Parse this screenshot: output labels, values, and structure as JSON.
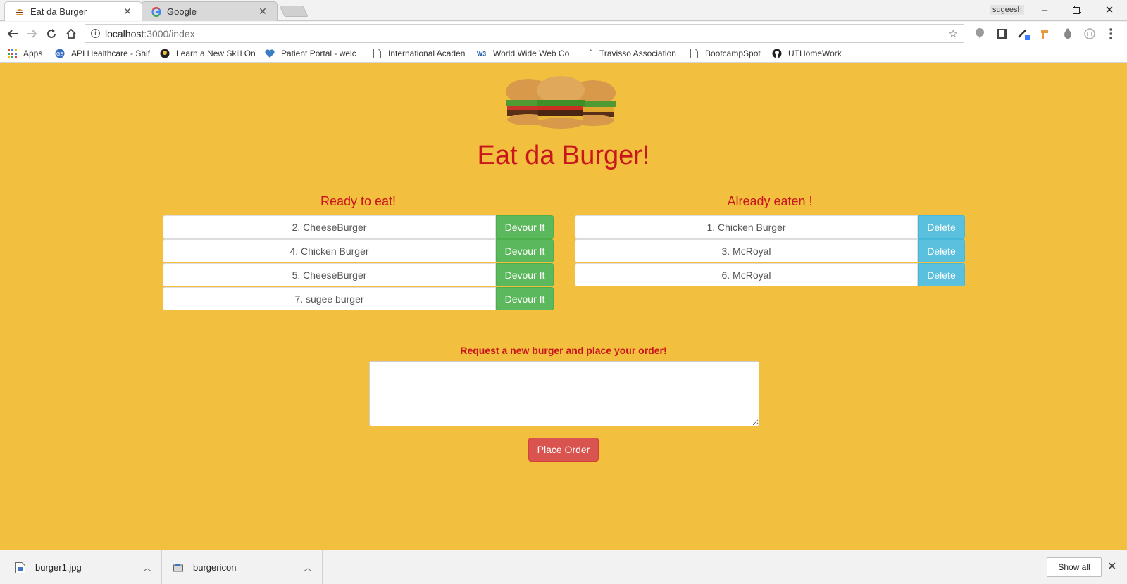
{
  "browser": {
    "tabs": [
      {
        "title": "Eat da Burger",
        "active": true
      },
      {
        "title": "Google",
        "active": false
      }
    ],
    "user": "sugeesh",
    "url": {
      "host": "localhost",
      "path": ":3000/index"
    },
    "bookmarks": [
      {
        "label": "Apps",
        "icon": "apps-grid-icon"
      },
      {
        "label": "API Healthcare - Shif",
        "icon": "ge-logo-icon"
      },
      {
        "label": "Learn a New Skill On",
        "icon": "lynda-icon"
      },
      {
        "label": "Patient Portal - welc",
        "icon": "heart-icon"
      },
      {
        "label": "International Acaden",
        "icon": "page-icon"
      },
      {
        "label": "World Wide Web Co",
        "icon": "w3c-icon"
      },
      {
        "label": "Travisso Association",
        "icon": "page-icon"
      },
      {
        "label": "BootcampSpot",
        "icon": "page-icon"
      },
      {
        "label": "UTHomeWork",
        "icon": "github-icon"
      }
    ]
  },
  "page": {
    "title": "Eat da Burger!",
    "ready_heading": "Ready to eat!",
    "eaten_heading": "Already eaten !",
    "ready": [
      {
        "name": "2. CheeseBurger",
        "action": "Devour It"
      },
      {
        "name": "4. Chicken Burger",
        "action": "Devour It"
      },
      {
        "name": "5. CheeseBurger",
        "action": "Devour It"
      },
      {
        "name": "7. sugee burger",
        "action": "Devour It"
      }
    ],
    "eaten": [
      {
        "name": "1. Chicken Burger",
        "action": "Delete"
      },
      {
        "name": "3. McRoyal",
        "action": "Delete"
      },
      {
        "name": "6. McRoyal",
        "action": "Delete"
      }
    ],
    "request_label": "Request a new burger and place your order!",
    "request_value": "",
    "order_button": "Place Order"
  },
  "downloads": {
    "items": [
      {
        "name": "burger1.jpg"
      },
      {
        "name": "burgericon"
      }
    ],
    "show_all": "Show all"
  },
  "colors": {
    "page_bg": "#f2c03e",
    "accent_red": "#c9151c",
    "devour_green": "#5cb85c",
    "delete_blue": "#5bc0de",
    "order_red": "#d9534f"
  }
}
